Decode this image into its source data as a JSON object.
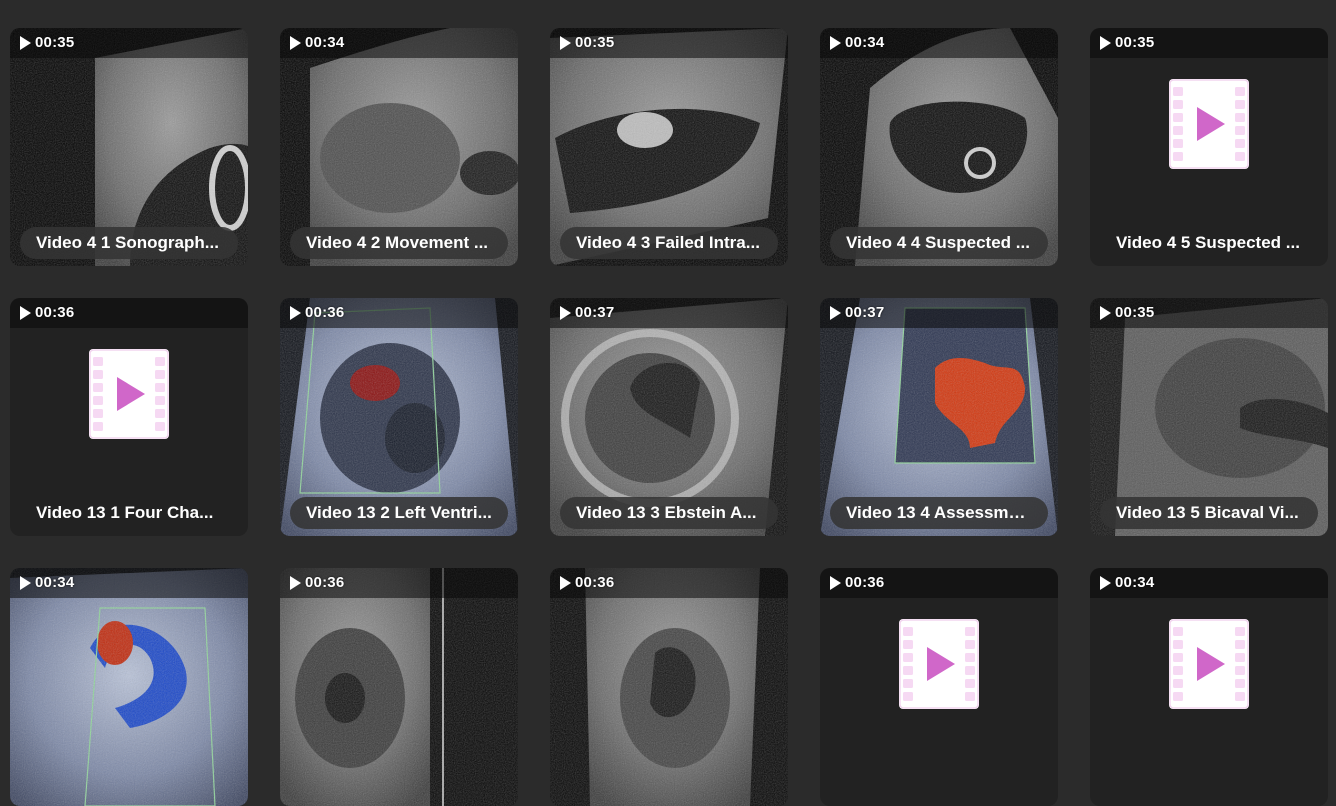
{
  "colors": {
    "page_background": "#2b2b2b",
    "card_background": "#222222",
    "placeholder_icon_bg": "#ffffff",
    "placeholder_icon_accent": "#d067c9",
    "doppler_box": "#8fd39a"
  },
  "videos": [
    {
      "duration": "00:35",
      "title": "Video 4 1 Sonograph...",
      "thumb": "us-gray-sac",
      "has_thumbnail": true
    },
    {
      "duration": "00:34",
      "title": "Video 4 2 Movement ...",
      "thumb": "us-gray-uterus",
      "has_thumbnail": true
    },
    {
      "duration": "00:35",
      "title": "Video 4 3 Failed Intra...",
      "thumb": "us-gray-elongated",
      "has_thumbnail": true
    },
    {
      "duration": "00:34",
      "title": "Video 4 4 Suspected ...",
      "thumb": "us-gray-round",
      "has_thumbnail": true
    },
    {
      "duration": "00:35",
      "title": "Video 4 5 Suspected ...",
      "thumb": "placeholder",
      "has_thumbnail": false
    },
    {
      "duration": "00:36",
      "title": "Video 13 1 Four Cha...",
      "thumb": "placeholder",
      "has_thumbnail": false
    },
    {
      "duration": "00:36",
      "title": "Video 13 2 Left Ventri...",
      "thumb": "us-blue-doppler-small",
      "has_thumbnail": true
    },
    {
      "duration": "00:37",
      "title": "Video 13 3 Ebstein A...",
      "thumb": "us-gray-heart",
      "has_thumbnail": true
    },
    {
      "duration": "00:37",
      "title": "Video 13 4 Assessme...",
      "thumb": "us-blue-doppler-red",
      "has_thumbnail": true
    },
    {
      "duration": "00:35",
      "title": "Video 13 5 Bicaval Vi...",
      "thumb": "us-gray-dark",
      "has_thumbnail": true
    },
    {
      "duration": "00:34",
      "title": "",
      "thumb": "us-blue-doppler-arch",
      "has_thumbnail": true
    },
    {
      "duration": "00:36",
      "title": "",
      "thumb": "us-gray-mmode",
      "has_thumbnail": true
    },
    {
      "duration": "00:36",
      "title": "",
      "thumb": "us-gray-fetal",
      "has_thumbnail": true
    },
    {
      "duration": "00:36",
      "title": "",
      "thumb": "placeholder",
      "has_thumbnail": false
    },
    {
      "duration": "00:34",
      "title": "",
      "thumb": "placeholder",
      "has_thumbnail": false
    }
  ]
}
